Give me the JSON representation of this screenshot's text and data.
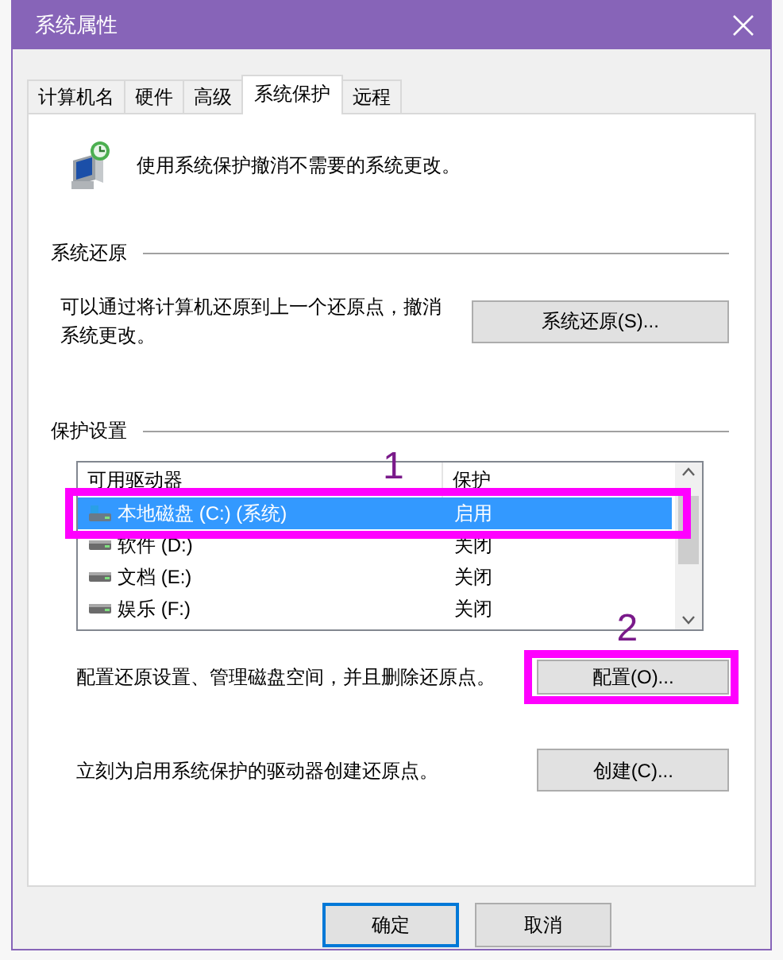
{
  "window": {
    "title": "系统属性"
  },
  "tabs": [
    {
      "label": "计算机名",
      "selected": false
    },
    {
      "label": "硬件",
      "selected": false
    },
    {
      "label": "高级",
      "selected": false
    },
    {
      "label": "系统保护",
      "selected": true
    },
    {
      "label": "远程",
      "selected": false
    }
  ],
  "intro": "使用系统保护撤消不需要的系统更改。",
  "restore": {
    "heading": "系统还原",
    "text": "可以通过将计算机还原到上一个还原点，撤消系统更改。",
    "button": "系统还原(S)..."
  },
  "protection": {
    "heading": "保护设置",
    "columns": [
      "可用驱动器",
      "保护"
    ],
    "rows": [
      {
        "kind": "system",
        "name": "本地磁盘 (C:) (系统)",
        "protection": "启用",
        "selected": true
      },
      {
        "kind": "drive",
        "name": "软件 (D:)",
        "protection": "关闭",
        "selected": false
      },
      {
        "kind": "drive",
        "name": "文档 (E:)",
        "protection": "关闭",
        "selected": false
      },
      {
        "kind": "drive",
        "name": "娱乐 (F:)",
        "protection": "关闭",
        "selected": false
      }
    ],
    "configure": {
      "text": "配置还原设置、管理磁盘空间，并且删除还原点。",
      "button": "配置(O)..."
    },
    "create": {
      "text": "立刻为启用系统保护的驱动器创建还原点。",
      "button": "创建(C)..."
    }
  },
  "buttons": [
    {
      "label": "确定",
      "default": true
    },
    {
      "label": "取消",
      "default": false
    }
  ],
  "annotations": [
    {
      "label": "1"
    },
    {
      "label": "2"
    }
  ]
}
